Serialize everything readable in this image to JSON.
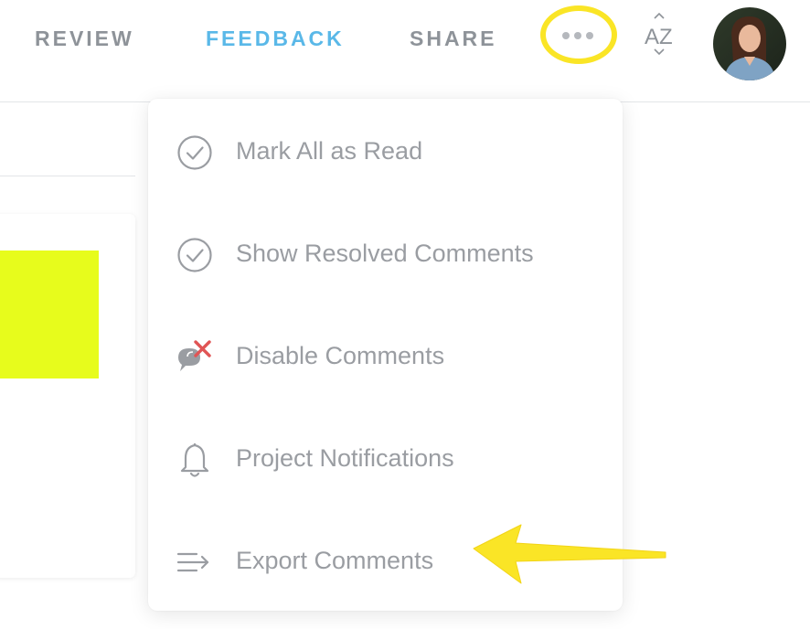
{
  "nav": {
    "tabs": [
      {
        "label": "REVIEW",
        "active": false
      },
      {
        "label": "FEEDBACK",
        "active": true
      },
      {
        "label": "SHARE",
        "active": false
      }
    ],
    "more_icon": "ellipsis-icon",
    "sort_icon": "sort-az-icon",
    "sort_label": "AZ",
    "avatar_icon": "user-avatar"
  },
  "menu": {
    "items": [
      {
        "label": "Mark All as Read",
        "icon": "check-circle-icon"
      },
      {
        "label": "Show Resolved Comments",
        "icon": "check-circle-icon"
      },
      {
        "label": "Disable Comments",
        "icon": "comment-disabled-icon"
      },
      {
        "label": "Project Notifications",
        "icon": "bell-icon"
      },
      {
        "label": "Export Comments",
        "icon": "export-list-icon"
      }
    ]
  },
  "colors": {
    "accent": "#5ab8e8",
    "highlight": "#fae526",
    "swatch": "#e7fc1c",
    "disable_x": "#e05555",
    "text_muted": "#9a9da2"
  }
}
